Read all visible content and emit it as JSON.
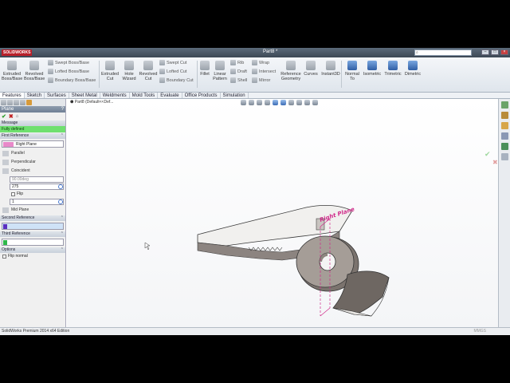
{
  "app": {
    "logo": "SOLIDWORKS",
    "document_title": "Part8 *",
    "search_placeholder": ""
  },
  "ribbon": {
    "extruded_boss": "Extruded Boss/Base",
    "revolved_boss": "Revolved Boss/Base",
    "swept_boss": "Swept Boss/Base",
    "lofted_boss": "Lofted Boss/Base",
    "boundary_boss": "Boundary Boss/Base",
    "extruded_cut": "Extruded Cut",
    "hole_wizard": "Hole Wizard",
    "revolved_cut": "Revolved Cut",
    "swept_cut": "Swept Cut",
    "lofted_cut": "Lofted Cut",
    "boundary_cut": "Boundary Cut",
    "fillet": "Fillet",
    "linear_pattern": "Linear Pattern",
    "rib": "Rib",
    "draft": "Draft",
    "shell": "Shell",
    "wrap": "Wrap",
    "intersect": "Intersect",
    "mirror": "Mirror",
    "reference_geometry": "Reference Geometry",
    "curves": "Curves",
    "instant3d": "Instant3D",
    "normal_to": "Normal To",
    "isometric": "Isometric",
    "trimetric": "Trimetric",
    "dimetric": "Dimetric"
  },
  "tabs": [
    "Features",
    "Sketch",
    "Surfaces",
    "Sheet Metal",
    "Weldments",
    "Mold Tools",
    "Evaluate",
    "Office Products",
    "Simulation"
  ],
  "property_manager": {
    "title": "Plane",
    "help": "?",
    "message_header": "Message",
    "message": "Fully defined",
    "first_reference": {
      "header": "First Reference",
      "selection": "Right Plane",
      "options": [
        "Parallel",
        "Perpendicular",
        "Coincident"
      ],
      "angle_value": "90.00deg",
      "distance_value": "275",
      "flip_label": "Flip",
      "instances_value": "1",
      "mid_plane_label": "Mid Plane"
    },
    "second_reference": {
      "header": "Second Reference"
    },
    "third_reference": {
      "header": "Third Reference"
    },
    "options": {
      "header": "Options",
      "flip_normal": "Flip normal"
    }
  },
  "viewport": {
    "tree_node": "Part8 (Default<<Def...",
    "plane_label": "Right Plane"
  },
  "status": {
    "left": "SolidWorks Premium 2014 x64 Edition",
    "right": "MMGS"
  },
  "colors": {
    "accent": "#b8202a",
    "message_bg": "#6fe06f",
    "plane_label": "#d02a8a"
  }
}
